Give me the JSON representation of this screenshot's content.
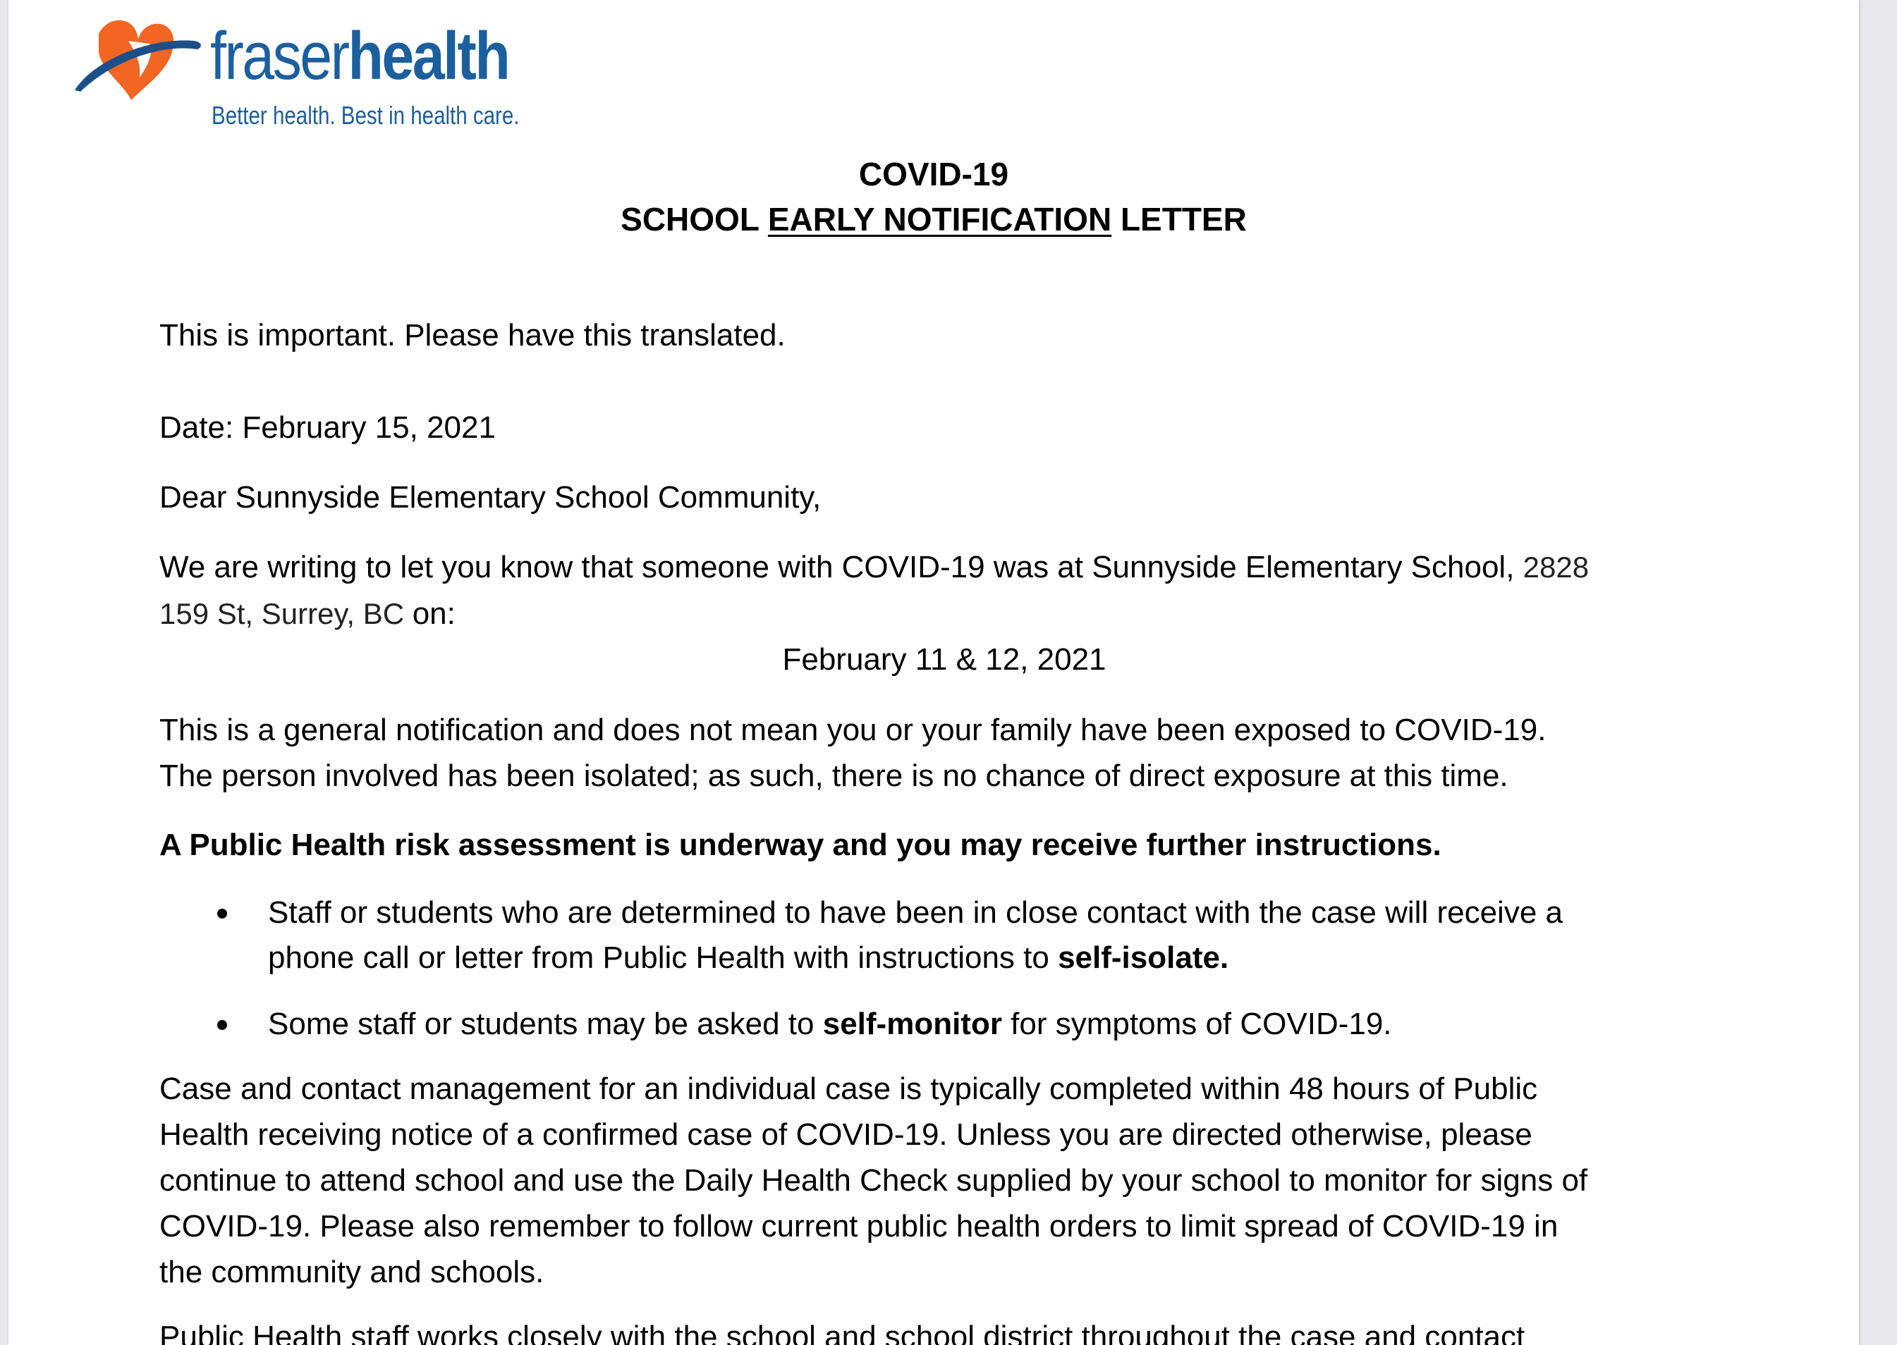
{
  "logo": {
    "brand_light": "fraser",
    "brand_bold": "health",
    "tagline": "Better health. Best in health care."
  },
  "heading": {
    "line1": "COVID-19",
    "line2_pre": "SCHOOL ",
    "line2_underlined": "EARLY NOTIFICATION",
    "line2_post": " LETTER"
  },
  "letter": {
    "translate_note": "This is important. Please have this translated.",
    "date": "Date: February 15, 2021",
    "greeting": "Dear Sunnyside Elementary School Community,",
    "intro_line1_text": "We are writing to let you know that someone with COVID-19 was at Sunnyside Elementary School, ",
    "intro_line1_address": "2828",
    "intro_line2_address": "159 St, Surrey, BC ",
    "intro_line2_text": " on:",
    "exposure_dates": "February 11 & 12, 2021",
    "general_line1": "This is a general notification and does not mean you or your family have been exposed to COVID-19.",
    "general_line2": "The person involved has been isolated; as such, there is no chance of direct exposure at this time.",
    "risk_assessment": "A Public Health risk assessment is underway and you may receive further instructions.",
    "bullet1_line1": "Staff or students who are determined to have been in close contact with the case will receive a",
    "bullet1_line2_pre": "phone call or letter from Public Health with instructions to ",
    "bullet1_line2_bold": "self-isolate.",
    "bullet2_pre": "Some staff or students may be asked to ",
    "bullet2_bold": "self-monitor",
    "bullet2_post": " for symptoms of COVID-19.",
    "case_mgmt_lines": [
      "Case and contact management for an individual case is typically completed within 48 hours of Public",
      "Health receiving notice of a confirmed case of COVID-19. Unless you are directed otherwise, please",
      "continue to attend school and use the Daily Health Check supplied by your school to monitor for signs of",
      "COVID-19. Please also remember to follow current public health orders to limit spread of COVID-19 in",
      "the community and schools."
    ],
    "closing_partial": "Public Health staff works closely with the school and school district throughout the case and contact"
  }
}
